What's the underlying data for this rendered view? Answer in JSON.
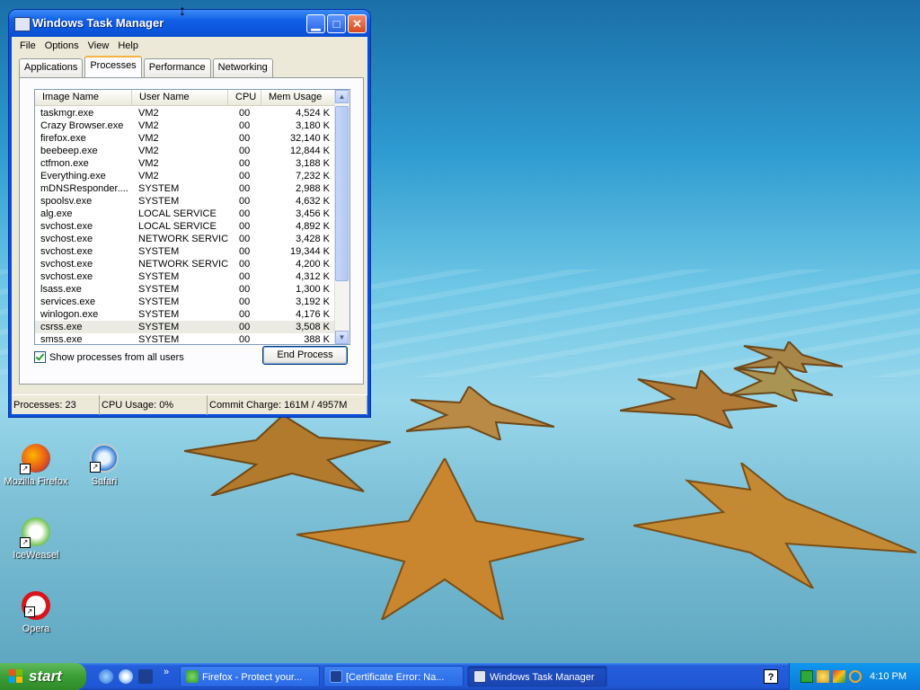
{
  "window": {
    "title": "Windows Task Manager",
    "menu": [
      "File",
      "Options",
      "View",
      "Help"
    ],
    "tabs": [
      "Applications",
      "Processes",
      "Performance",
      "Networking"
    ],
    "active_tab": "Processes",
    "columns": [
      "Image Name",
      "User Name",
      "CPU",
      "Mem Usage"
    ],
    "processes": [
      {
        "image": "taskmgr.exe",
        "user": "VM2",
        "cpu": "00",
        "mem": "4,524 K"
      },
      {
        "image": "Crazy Browser.exe",
        "user": "VM2",
        "cpu": "00",
        "mem": "3,180 K"
      },
      {
        "image": "firefox.exe",
        "user": "VM2",
        "cpu": "00",
        "mem": "32,140 K"
      },
      {
        "image": "beebeep.exe",
        "user": "VM2",
        "cpu": "00",
        "mem": "12,844 K"
      },
      {
        "image": "ctfmon.exe",
        "user": "VM2",
        "cpu": "00",
        "mem": "3,188 K"
      },
      {
        "image": "Everything.exe",
        "user": "VM2",
        "cpu": "00",
        "mem": "7,232 K"
      },
      {
        "image": "mDNSResponder....",
        "user": "SYSTEM",
        "cpu": "00",
        "mem": "2,988 K"
      },
      {
        "image": "spoolsv.exe",
        "user": "SYSTEM",
        "cpu": "00",
        "mem": "4,632 K"
      },
      {
        "image": "alg.exe",
        "user": "LOCAL SERVICE",
        "cpu": "00",
        "mem": "3,456 K"
      },
      {
        "image": "svchost.exe",
        "user": "LOCAL SERVICE",
        "cpu": "00",
        "mem": "4,892 K"
      },
      {
        "image": "svchost.exe",
        "user": "NETWORK SERVICE",
        "cpu": "00",
        "mem": "3,428 K"
      },
      {
        "image": "svchost.exe",
        "user": "SYSTEM",
        "cpu": "00",
        "mem": "19,344 K"
      },
      {
        "image": "svchost.exe",
        "user": "NETWORK SERVICE",
        "cpu": "00",
        "mem": "4,200 K"
      },
      {
        "image": "svchost.exe",
        "user": "SYSTEM",
        "cpu": "00",
        "mem": "4,312 K"
      },
      {
        "image": "lsass.exe",
        "user": "SYSTEM",
        "cpu": "00",
        "mem": "1,300 K"
      },
      {
        "image": "services.exe",
        "user": "SYSTEM",
        "cpu": "00",
        "mem": "3,192 K"
      },
      {
        "image": "winlogon.exe",
        "user": "SYSTEM",
        "cpu": "00",
        "mem": "4,176 K"
      },
      {
        "image": "csrss.exe",
        "user": "SYSTEM",
        "cpu": "00",
        "mem": "3,508 K"
      },
      {
        "image": "smss.exe",
        "user": "SYSTEM",
        "cpu": "00",
        "mem": "388 K"
      }
    ],
    "selected_process": "csrss.exe",
    "show_all_label": "Show processes from all users",
    "show_all_checked": true,
    "end_process_label": "End Process",
    "status": {
      "processes": "Processes: 23",
      "cpu": "CPU Usage: 0%",
      "commit": "Commit Charge: 161M / 4957M"
    }
  },
  "desktop_icons": [
    {
      "label": "Mozilla Firefox",
      "icon": "firefox-icon"
    },
    {
      "label": "Safari",
      "icon": "safari-icon"
    },
    {
      "label": "IceWeasel",
      "icon": "iceweasel-icon"
    },
    {
      "label": "Opera",
      "icon": "opera-icon"
    }
  ],
  "taskbar": {
    "start_label": "start",
    "tasks": [
      {
        "label": "Firefox - Protect your...",
        "icon": "firefox-icon"
      },
      {
        "label": "[Certificate Error: Na...",
        "icon": "crazy-browser-icon"
      },
      {
        "label": "Windows Task Manager",
        "icon": "task-manager-icon"
      }
    ],
    "help_label": "?",
    "clock": "4:10 PM"
  },
  "colors": {
    "taskbar_blue": "#245edb",
    "start_green": "#3b9e35",
    "tray_blue": "#0b77d8",
    "window_chrome": "#0a4ed8",
    "window_face": "#ece9d8"
  }
}
